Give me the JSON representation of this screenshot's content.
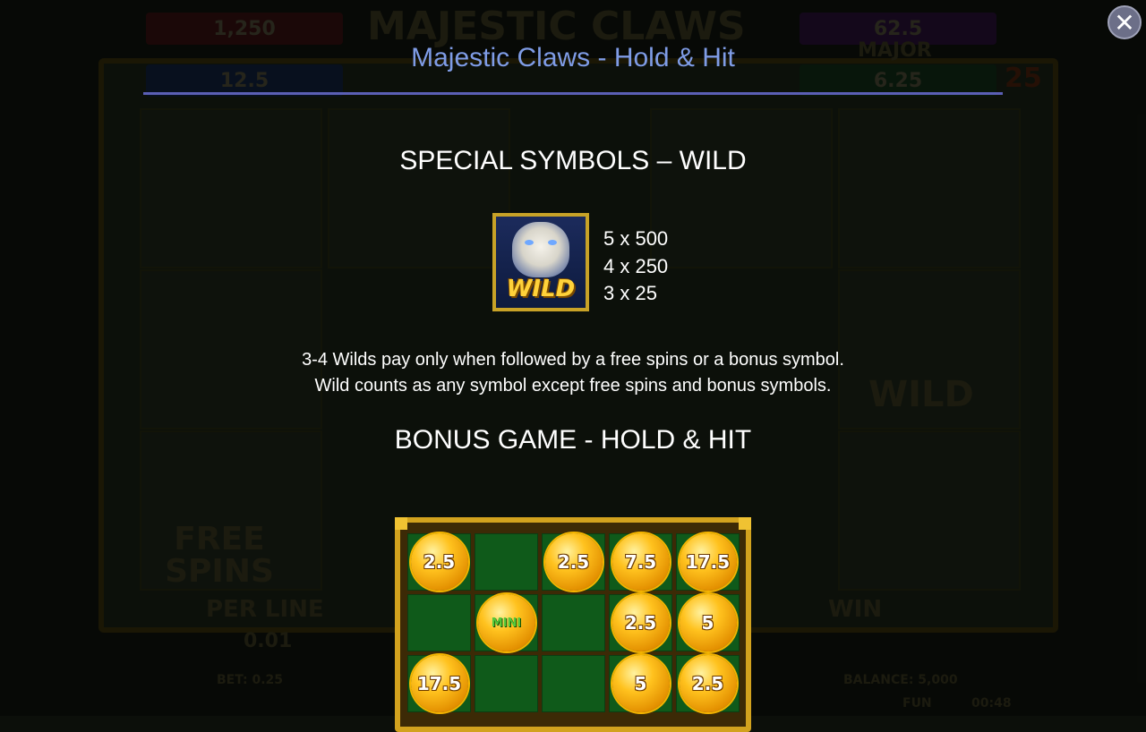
{
  "dialog": {
    "title": "Majestic Claws - Hold & Hit",
    "close_icon": "close-icon"
  },
  "wild_section": {
    "heading": "SPECIAL SYMBOLS – WILD",
    "symbol_text": "WILD",
    "payouts": [
      "5 x 500",
      "4 x 250",
      "3 x 25"
    ],
    "description": [
      "3-4 Wilds pay only when followed by a free spins or a bonus symbol.",
      "Wild counts as any symbol except free spins and bonus symbols."
    ]
  },
  "bonus_section": {
    "heading": "BONUS GAME - HOLD & HIT",
    "grid": [
      [
        "2.5",
        "",
        "2.5",
        "7.5",
        "17.5"
      ],
      [
        "",
        "MINI",
        "",
        "2.5",
        "5"
      ],
      [
        "17.5",
        "",
        "",
        "5",
        "2.5"
      ]
    ]
  },
  "background": {
    "jackpots": [
      "1,250",
      "12.5",
      "62.5",
      "6.25"
    ],
    "jackpot_labels": [
      "MAJOR"
    ],
    "game_logo": "MAJESTIC CLAWS",
    "bottom_labels": [
      "PER LINE",
      "0.01",
      "WIN",
      "BET: 0.25",
      "BALANCE: 5,000",
      "FUN",
      "00:48"
    ],
    "lines_badge": "25",
    "reel_symbols": [
      "FREE SPINS",
      "WILD"
    ]
  },
  "colors": {
    "title": "#7f9ce6",
    "rule": "#5b5fb5",
    "frame_gold": "#d2a21e",
    "grid_green": "#0f5a1a"
  }
}
